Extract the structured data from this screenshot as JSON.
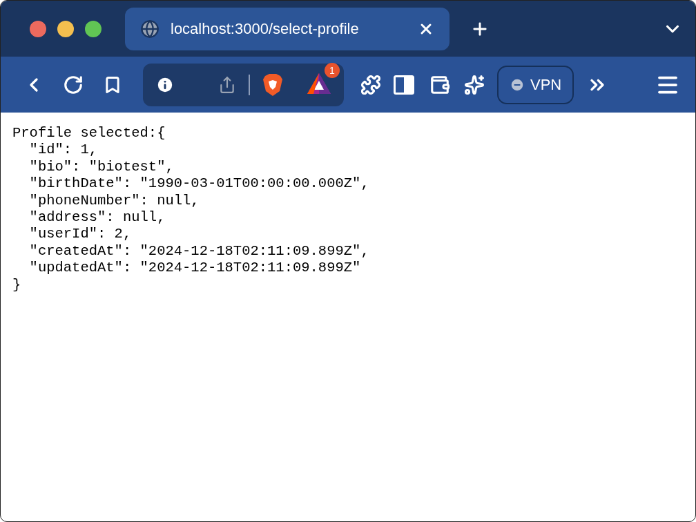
{
  "tab": {
    "title": "localhost:3000/select-profile"
  },
  "toolbar": {
    "badge_count": "1",
    "vpn_label": "VPN"
  },
  "content_lines": [
    "Profile selected:{",
    "  \"id\": 1,",
    "  \"bio\": \"biotest\",",
    "  \"birthDate\": \"1990-03-01T00:00:00.000Z\",",
    "  \"phoneNumber\": null,",
    "  \"address\": null,",
    "  \"userId\": 2,",
    "  \"createdAt\": \"2024-12-18T02:11:09.899Z\",",
    "  \"updatedAt\": \"2024-12-18T02:11:09.899Z\"",
    "}"
  ]
}
